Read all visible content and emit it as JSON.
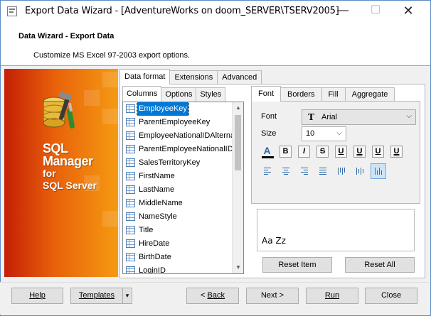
{
  "window": {
    "title": "Export Data Wizard - [AdventureWorks on doom_SERVER\\TSERV2005]",
    "controls": {
      "minimize": "—",
      "maximize": "☐",
      "close": "✕"
    }
  },
  "header": {
    "title": "Data Wizard - Export Data",
    "subtitle": "Customize MS Excel 97-2003 export options."
  },
  "brand": {
    "line1": "SQL",
    "line2": "Manager",
    "line3": "for",
    "line4": "SQL Server"
  },
  "main_tabs": [
    {
      "label": "Data format",
      "active": true
    },
    {
      "label": "Extensions",
      "active": false
    },
    {
      "label": "Advanced",
      "active": false
    }
  ],
  "sub_tabs": [
    {
      "label": "Columns",
      "active": true
    },
    {
      "label": "Options",
      "active": false
    },
    {
      "label": "Styles",
      "active": false
    }
  ],
  "columns": [
    {
      "name": "EmployeeKey",
      "selected": true
    },
    {
      "name": "ParentEmployeeKey",
      "selected": false
    },
    {
      "name": "EmployeeNationalIDAlternateKey",
      "selected": false
    },
    {
      "name": "ParentEmployeeNationalIDAlternateKey",
      "selected": false
    },
    {
      "name": "SalesTerritoryKey",
      "selected": false
    },
    {
      "name": "FirstName",
      "selected": false
    },
    {
      "name": "LastName",
      "selected": false
    },
    {
      "name": "MiddleName",
      "selected": false
    },
    {
      "name": "NameStyle",
      "selected": false
    },
    {
      "name": "Title",
      "selected": false
    },
    {
      "name": "HireDate",
      "selected": false
    },
    {
      "name": "BirthDate",
      "selected": false
    },
    {
      "name": "LoginID",
      "selected": false
    }
  ],
  "format_tabs": [
    {
      "label": "Font",
      "active": true
    },
    {
      "label": "Borders",
      "active": false
    },
    {
      "label": "Fill",
      "active": false
    },
    {
      "label": "Aggregate",
      "active": false
    }
  ],
  "font": {
    "font_label": "Font",
    "font_value": "Arial",
    "truetype_glyph": "T",
    "size_label": "Size",
    "size_value": "10",
    "style_buttons": [
      "B",
      "I",
      "S",
      "U",
      "U",
      "U",
      "U"
    ],
    "color_glyph": "A",
    "color_bar": "#000000",
    "align_selected_index": 6
  },
  "preview": {
    "text": "Aa Zz"
  },
  "actions": {
    "reset_item": "Reset Item",
    "reset_all": "Reset All"
  },
  "footer": {
    "help": "Help",
    "templates": "Templates",
    "templates_arrow": "▾",
    "back_arrow": "< ",
    "back": "Back",
    "next": "Next >",
    "run": "Run",
    "close": "Close"
  },
  "colors": {
    "accent": "#0078d7",
    "brand_dark": "#c51f06",
    "brand_light": "#f59a12"
  }
}
